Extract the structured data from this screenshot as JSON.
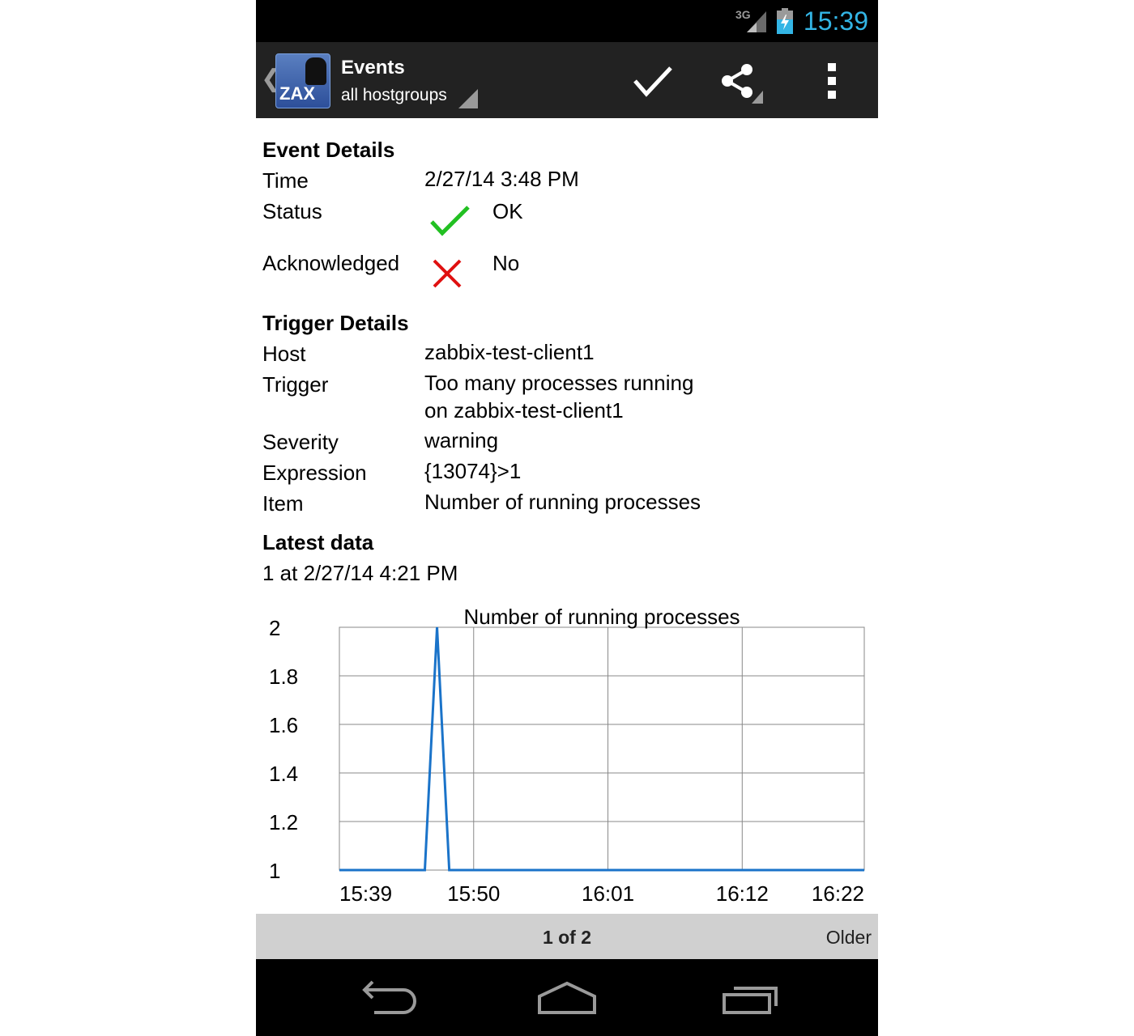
{
  "status_bar": {
    "network": "3G",
    "time": "15:39"
  },
  "action_bar": {
    "title": "Events",
    "subtitle": "all hostgroups"
  },
  "event_details": {
    "heading": "Event Details",
    "time_label": "Time",
    "time_value": "2/27/14 3:48 PM",
    "status_label": "Status",
    "status_value": "OK",
    "ack_label": "Acknowledged",
    "ack_value": "No"
  },
  "trigger_details": {
    "heading": "Trigger Details",
    "host_label": "Host",
    "host_value": "zabbix-test-client1",
    "trigger_label": "Trigger",
    "trigger_value_line1": "Too many processes running",
    "trigger_value_line2": "on zabbix-test-client1",
    "severity_label": "Severity",
    "severity_value": "warning",
    "expression_label": "Expression",
    "expression_value": "{13074}>1",
    "item_label": "Item",
    "item_value": "Number of running processes"
  },
  "latest_data": {
    "heading": "Latest data",
    "value": "1  at 2/27/14 4:21 PM"
  },
  "chart_data": {
    "type": "line",
    "title": "Number of running processes",
    "xlabel": "",
    "ylabel": "",
    "ylim": [
      1,
      2
    ],
    "yticks": [
      "2",
      "1.8",
      "1.6",
      "1.4",
      "1.2",
      "1"
    ],
    "xticks": [
      "15:39",
      "15:50",
      "16:01",
      "16:12",
      "16:22"
    ],
    "series": [
      {
        "x": [
          "15:39",
          "15:46",
          "15:47",
          "15:48",
          "16:22"
        ],
        "values": [
          1,
          1,
          2,
          1,
          1
        ]
      }
    ],
    "grid": true,
    "color": "#1a73c9"
  },
  "pager": {
    "page": "1 of 2",
    "older": "Older"
  }
}
